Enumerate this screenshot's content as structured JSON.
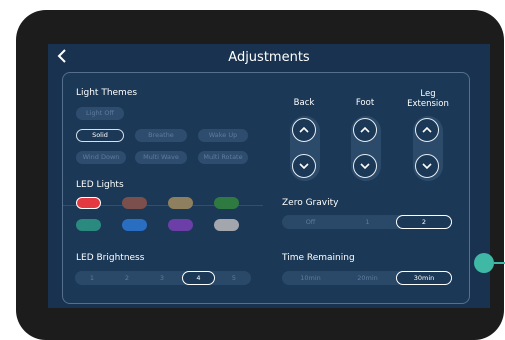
{
  "header": {
    "title": "Adjustments",
    "back_icon": "chevron-left-icon"
  },
  "light_themes": {
    "label": "Light Themes",
    "options": [
      {
        "label": "Light Off",
        "active": false
      },
      {
        "label": "Solid",
        "active": true
      },
      {
        "label": "Breathe",
        "active": false
      },
      {
        "label": "Wake Up",
        "active": false
      },
      {
        "label": "Wind Down",
        "active": false
      },
      {
        "label": "Multi Wave",
        "active": false
      },
      {
        "label": "Multi Rotate",
        "active": false
      }
    ]
  },
  "led_lights": {
    "label": "LED Lights",
    "colors": [
      "#e23a40",
      "#7a4f4c",
      "#8e7f5f",
      "#2f7a40",
      "#2a8a80",
      "#2a6ec2",
      "#6b3ea8",
      "#a3a6ad"
    ],
    "selected_index": 0
  },
  "led_brightness": {
    "label": "LED Brightness",
    "levels": [
      "1",
      "2",
      "3",
      "4",
      "5"
    ],
    "selected": "4"
  },
  "controls": {
    "back": "Back",
    "foot": "Foot",
    "leg_line1": "Leg",
    "leg_line2": "Extension"
  },
  "zero_gravity": {
    "label": "Zero Gravity",
    "options": [
      "Off",
      "1",
      "2"
    ],
    "selected": "2"
  },
  "time_remaining": {
    "label": "Time Remaining",
    "options": [
      "10min",
      "20min",
      "30min"
    ],
    "selected": "30min"
  },
  "colors": {
    "accent": "#3fb8a6",
    "screen_bg": "#18324f",
    "frame": "#1c1c1c"
  }
}
